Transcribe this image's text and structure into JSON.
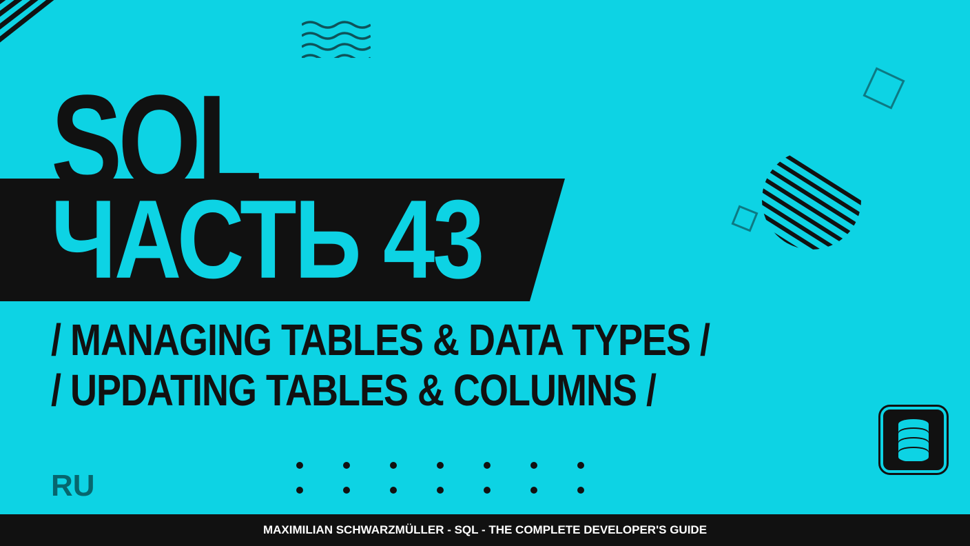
{
  "title": "SQL",
  "part_label": "ЧАСТЬ 43",
  "subtitle_line1": "/ MANAGING TABLES & DATA TYPES /",
  "subtitle_line2": "/ UPDATING TABLES & COLUMNS /",
  "language_badge": "RU",
  "footer_text": "MAXIMILIAN SCHWARZMÜLLER - SQL - THE COMPLETE DEVELOPER'S GUIDE",
  "colors": {
    "background": "#0dd3e4",
    "dark": "#111111",
    "accent_dark_teal": "#0e535a"
  }
}
